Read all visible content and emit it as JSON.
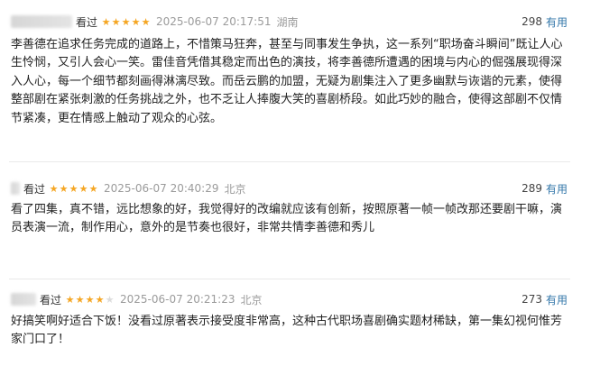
{
  "reviews": [
    {
      "label": "看过",
      "rating": 5,
      "date": "2025-06-07 20:17:51",
      "location": "湖南",
      "useful_count": "298",
      "useful_label": "有用",
      "content": "李善德在追求任务完成的道路上，不惜策马狂奔，甚至与同事发生争执，这一系列“职场奋斗瞬间”既让人心生怜悯，又引人会心一笑。雷佳音凭借其稳定而出色的演技，将李善德所遭遇的困境与内心的倔强展现得深入人心，每一个细节都刻画得淋漓尽致。而岳云鹏的加盟，无疑为剧集注入了更多幽默与诙谐的元素，使得整部剧在紧张刺激的任务挑战之外，也不乏让人捧腹大笑的喜剧桥段。如此巧妙的融合，使得这部剧不仅情节紧凑，更在情感上触动了观众的心弦。"
    },
    {
      "label": "看过",
      "rating": 5,
      "date": "2025-06-07 20:40:29",
      "location": "北京",
      "useful_count": "289",
      "useful_label": "有用",
      "content": "看了四集，真不错，远比想象的好，我觉得好的改编就应该有创新，按照原著一帧一帧改那还要剧干嘛，演员表演一流，制作用心，意外的是节奏也很好，非常共情李善德和秀儿"
    },
    {
      "label": "看过",
      "rating": 4,
      "date": "2025-06-07 20:21:23",
      "location": "北京",
      "useful_count": "273",
      "useful_label": "有用",
      "content": "好搞笑啊好适合下饭！没看过原著表示接受度非常高，这种古代职场喜剧确实题材稀缺，第一集幻视何惟芳家门口了！"
    }
  ]
}
